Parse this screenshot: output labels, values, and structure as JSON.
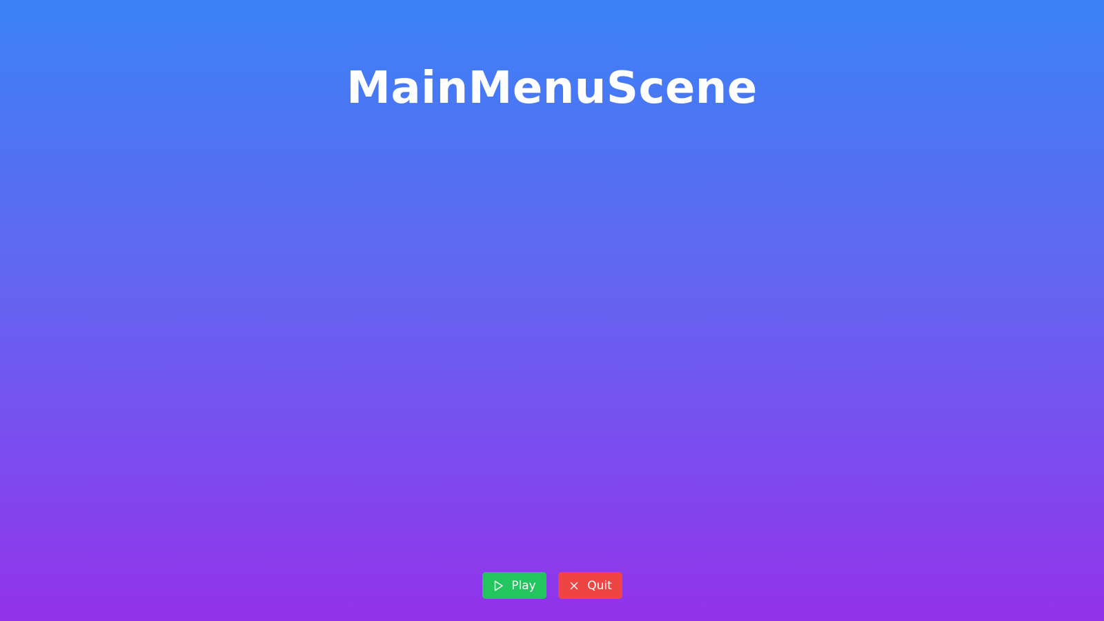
{
  "scene": {
    "title": "MainMenuScene",
    "background": {
      "top_color": "#3b82f6",
      "bottom_color": "#9333ea"
    }
  },
  "menu": {
    "play": {
      "label": "Play",
      "icon": "play-icon",
      "color": "#22c55e"
    },
    "quit": {
      "label": "Quit",
      "icon": "close-icon",
      "color": "#ef4444"
    }
  }
}
